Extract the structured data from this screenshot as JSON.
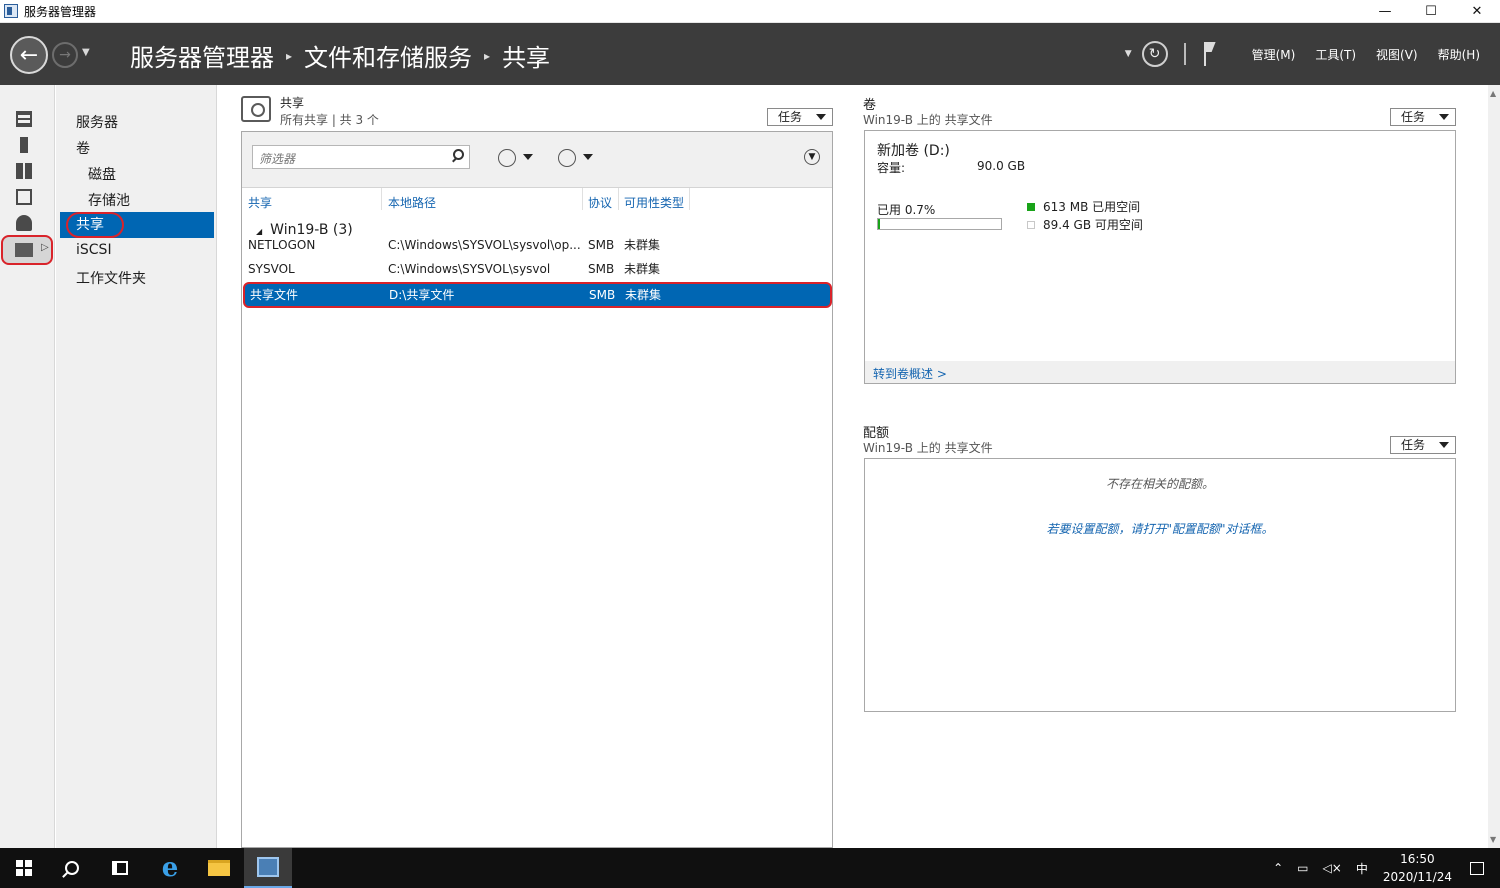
{
  "window": {
    "title": "服务器管理器",
    "controls": {
      "minimize": "—",
      "maximize": "☐",
      "close": "✕"
    }
  },
  "header": {
    "breadcrumb": [
      "服务器管理器",
      "文件和存储服务",
      "共享"
    ],
    "separator": "▸",
    "menu": [
      "管理(M)",
      "工具(T)",
      "视图(V)",
      "帮助(H)"
    ]
  },
  "nav": {
    "items": [
      {
        "label": "服务器"
      },
      {
        "label": "卷"
      },
      {
        "label": "磁盘"
      },
      {
        "label": "存储池"
      },
      {
        "label": "共享"
      },
      {
        "label": "iSCSI"
      },
      {
        "label": "工作文件夹"
      }
    ],
    "selected": "共享"
  },
  "shares": {
    "title": "共享",
    "subtitle": "所有共享 | 共 3 个",
    "tasks_label": "任务",
    "filter_placeholder": "筛选器",
    "columns": [
      "共享",
      "本地路径",
      "协议",
      "可用性类型"
    ],
    "group": "Win19-B (3)",
    "rows": [
      {
        "share": "NETLOGON",
        "path": "C:\\Windows\\SYSVOL\\sysvol\\op...",
        "protocol": "SMB",
        "availability": "未群集"
      },
      {
        "share": "SYSVOL",
        "path": "C:\\Windows\\SYSVOL\\sysvol",
        "protocol": "SMB",
        "availability": "未群集"
      },
      {
        "share": "共享文件",
        "path": "D:\\共享文件",
        "protocol": "SMB",
        "availability": "未群集"
      }
    ],
    "selected_row": 2
  },
  "volume": {
    "title": "卷",
    "subtitle": "Win19-B 上的 共享文件",
    "tasks_label": "任务",
    "name": "新加卷 (D:)",
    "capacity_label": "容量:",
    "capacity_value": "90.0 GB",
    "used_label": "已用 0.7%",
    "used_fraction": 0.007,
    "used_space": "613 MB 已用空间",
    "free_space": "89.4 GB 可用空间",
    "used_color": "#19a319",
    "link": "转到卷概述 >"
  },
  "quota": {
    "title": "配额",
    "subtitle": "Win19-B 上的 共享文件",
    "tasks_label": "任务",
    "empty_message": "不存在相关的配额。",
    "hint": "若要设置配额，请打开\"配置配额\"对话框。"
  },
  "taskbar": {
    "time": "16:50",
    "date": "2020/11/24",
    "ime": "中"
  }
}
